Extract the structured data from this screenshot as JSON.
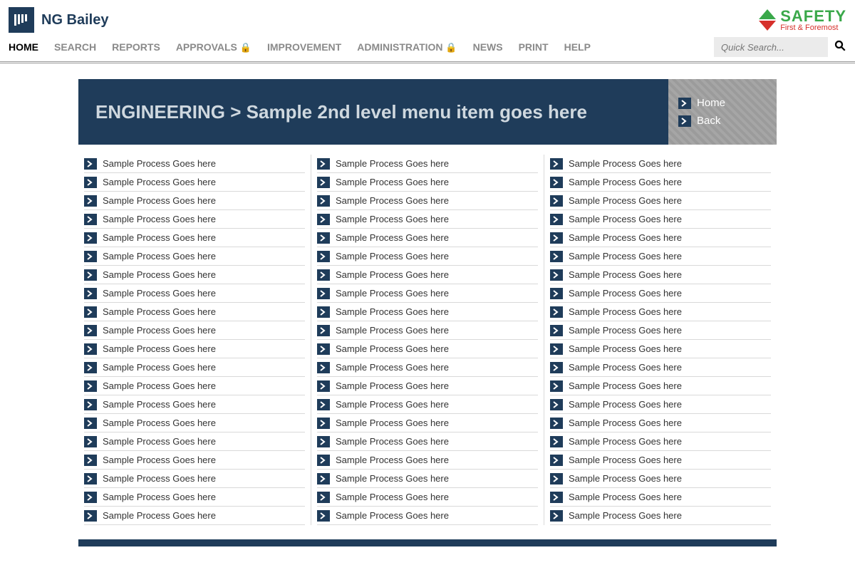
{
  "brand": {
    "name": "NG Bailey"
  },
  "safety": {
    "title": "SAFETY",
    "tagline": "First & Foremost"
  },
  "nav": {
    "items": [
      {
        "label": "HOME",
        "active": true,
        "locked": false
      },
      {
        "label": "SEARCH",
        "active": false,
        "locked": false
      },
      {
        "label": "REPORTS",
        "active": false,
        "locked": false
      },
      {
        "label": "APPROVALS",
        "active": false,
        "locked": true
      },
      {
        "label": "IMPROVEMENT",
        "active": false,
        "locked": false
      },
      {
        "label": "ADMINISTRATION",
        "active": false,
        "locked": true
      },
      {
        "label": "NEWS",
        "active": false,
        "locked": false
      },
      {
        "label": "PRINT",
        "active": false,
        "locked": false
      },
      {
        "label": "HELP",
        "active": false,
        "locked": false
      }
    ]
  },
  "search": {
    "placeholder": "Quick Search..."
  },
  "breadcrumb": "ENGINEERING > Sample 2nd level menu item goes here",
  "side": {
    "home": "Home",
    "back": "Back"
  },
  "process_item_label": "Sample Process Goes here",
  "columns": 3,
  "rows_per_column": 20
}
